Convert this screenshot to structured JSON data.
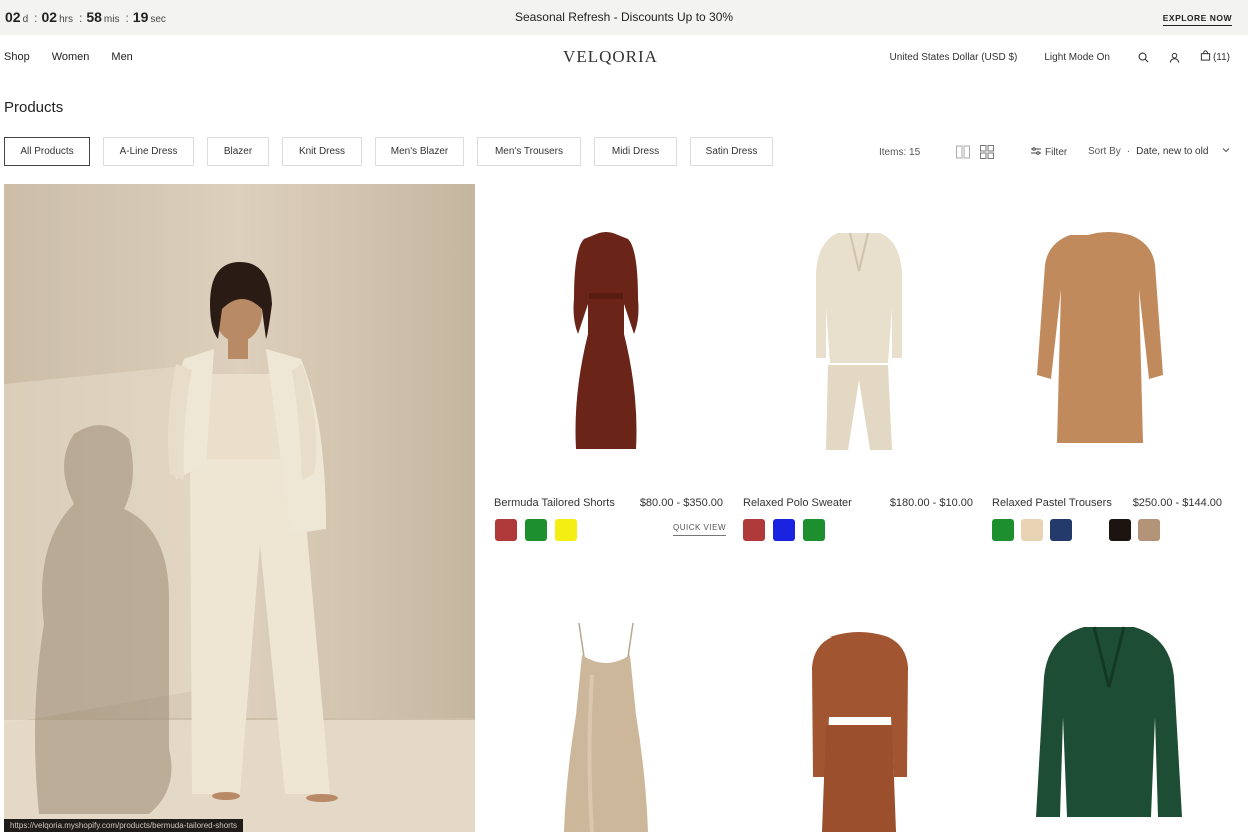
{
  "announcement": {
    "countdown": {
      "days": "02",
      "days_unit": "d",
      "hours": "02",
      "hours_unit": "hrs",
      "mins": "58",
      "mins_unit": "mis",
      "secs": "19",
      "secs_unit": "sec"
    },
    "promo": "Seasonal Refresh - Discounts Up to 30%",
    "cta": "EXPLORE NOW"
  },
  "header": {
    "nav": [
      "Shop",
      "Women",
      "Men"
    ],
    "logo": "VELQORIA",
    "currency": "United States Dollar (USD $)",
    "mode": "Light Mode On",
    "cart_count": "(11)"
  },
  "page": {
    "title": "Products"
  },
  "filters": [
    "All Products",
    "A-Line Dress",
    "Blazer",
    "Knit Dress",
    "Men's Blazer",
    "Men's Trousers",
    "Midi Dress",
    "Satin Dress"
  ],
  "toolbar": {
    "items_label": "Items: 15",
    "filter_label": "Filter",
    "sort_label": "Sort By",
    "sort_value": "Date, new to old"
  },
  "hero": {
    "caption": "https://velqoria.myshopify.com/products/bermuda-tailored-shorts"
  },
  "products": [
    {
      "name": "Bermuda Tailored Shorts",
      "price": "$80.00 - $350.00",
      "quick_view": "QUICK VIEW",
      "swatches": [
        "#b03a3a",
        "#1e8f2e",
        "#f5ee12"
      ]
    },
    {
      "name": "Relaxed Polo Sweater",
      "price": "$180.00 - $10.00",
      "swatches": [
        "#b03a3a",
        "#1a24e0",
        "#1e8f2e"
      ]
    },
    {
      "name": "Relaxed Pastel Trousers",
      "price": "$250.00 - $144.00",
      "swatches": [
        "#1e8f2e",
        "#e8d4b4",
        "#243a6b",
        "#1c1410",
        "#b39478"
      ]
    },
    {
      "name": ""
    },
    {
      "name": ""
    },
    {
      "name": ""
    }
  ],
  "icons": {
    "search": "search-icon",
    "account": "user-icon",
    "cart": "bag-icon",
    "filter": "sliders-icon",
    "sort_chevron": "chevron-down-icon",
    "view_two": "two-column-icon",
    "view_grid": "grid-icon"
  }
}
